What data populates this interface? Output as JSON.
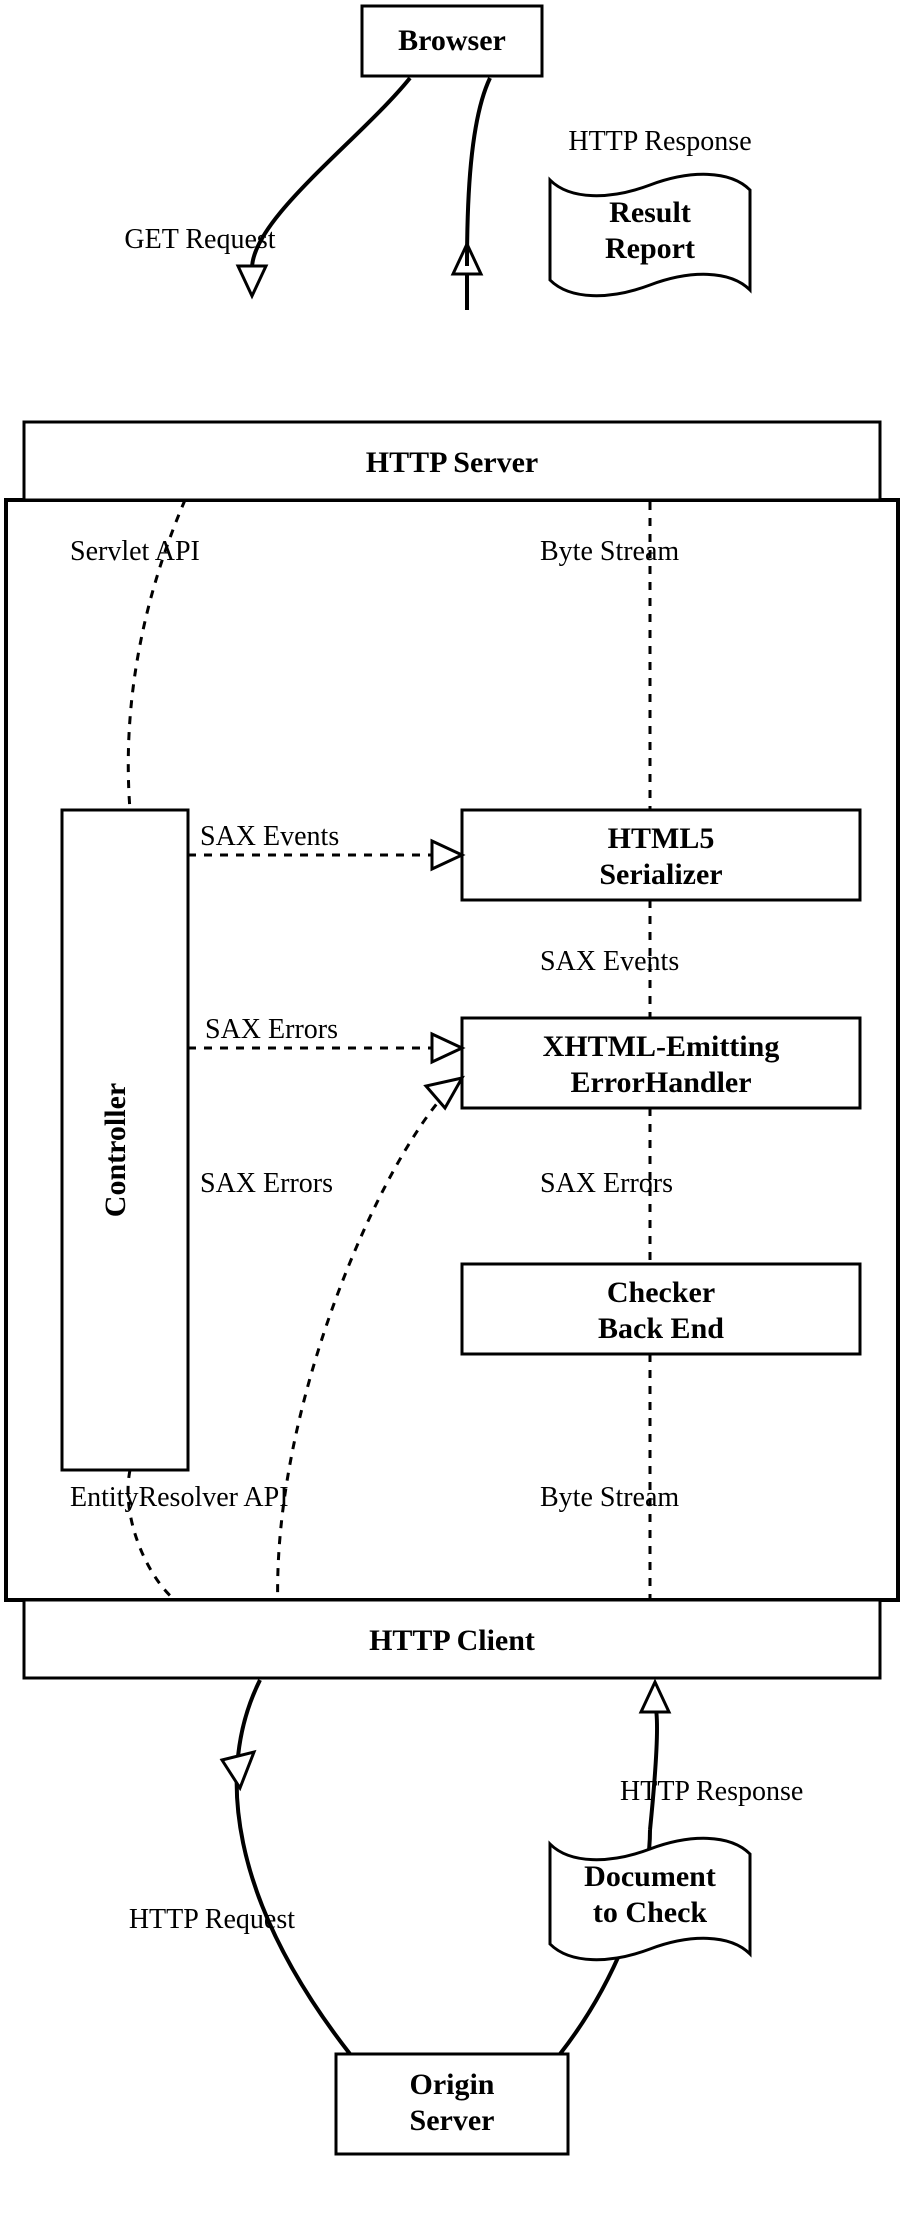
{
  "nodes": {
    "browser": "Browser",
    "result_report_l1": "Result",
    "result_report_l2": "Report",
    "http_server": "HTTP Server",
    "controller": "Controller",
    "html5_serializer_l1": "HTML5",
    "html5_serializer_l2": "Serializer",
    "xhtml_errorhandler_l1": "XHTML-Emitting",
    "xhtml_errorhandler_l2": "ErrorHandler",
    "checker_backend_l1": "Checker",
    "checker_backend_l2": "Back End",
    "http_client": "HTTP Client",
    "document_to_check_l1": "Document",
    "document_to_check_l2": "to Check",
    "origin_server_l1": "Origin",
    "origin_server_l2": "Server"
  },
  "edges": {
    "browser_to_server_left": "GET Request",
    "server_to_browser_right": "HTTP Response",
    "servlet_api": "Servlet API",
    "byte_stream_u": "Byte Stream",
    "sax_events_l": "SAX Events",
    "sax_events_r": "SAX Events",
    "sax_errors_l": "SAX Errors",
    "sax_errors_bl": "SAX Errors",
    "sax_errors_r": "SAX Errors",
    "entityresolver_api": "EntityResolver API",
    "byte_stream_l": "Byte Stream",
    "client_to_origin_left": "HTTP Request",
    "origin_to_client_right": "HTTP Response"
  }
}
